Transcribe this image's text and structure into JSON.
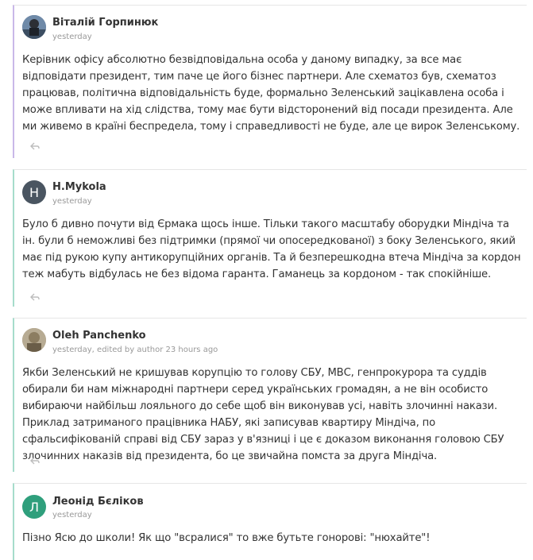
{
  "comments": [
    {
      "author": "Віталій Горпинюк",
      "meta": "yesterday",
      "text": "Керівник офісу абсолютно безвідповідальна особа у даному випадку, за все має відповідати президент, тим паче це його бізнес партнери. Але схематоз був, схематоз працював, політична відповідальність буде, формально Зеленський зацікавлена особа і може впливати на хід слідства, тому має бути відсторонений від посади президента. Але ми живемо в країні беспредела, тому і справедливості не буде, але це вирок Зеленському.",
      "avatar": "photo"
    },
    {
      "author": "H.Mykola",
      "meta": "yesterday",
      "text": "Було б дивно почути від Єрмака щось інше. Тільки такого масштабу оборудки Міндіча та ін. були б неможливі без підтримки (прямої чи опосередкованої) з боку Зеленського, який має під рукою купу антикорупційних органів. Та й безперешкодна втеча Міндіча за кордон теж мабуть відбулась не без відома гаранта. Гаманець за кордоном - так спокійніше.",
      "avatar_letter": "H"
    },
    {
      "author": "Oleh Panchenko",
      "meta": "yesterday, edited by author 23 hours ago",
      "text": "Якби Зеленський не кришував корупцію то голову СБУ, МВС, генпрокурора та суддів обирали би нам міжнародні партнери серед українських громадян, а не він особисто вибираючи найбільш лояльного до себе щоб він виконував усі, навіть злочинні накази. Приклад затриманого працівника НАБУ, які записував квартиру Міндіча, по сфальсифікованій справі від СБУ зараз у в'язниці і це є доказом виконання головою СБУ злочинних наказів від президента, бо це звичайна помста за друга Міндіча.",
      "avatar": "photo"
    },
    {
      "author": "Леонід Бєліков",
      "meta": "yesterday",
      "text": "Пізно Ясю до школи! Як що \"всралися\" то вже бутьте гоноровi: \"нюхайте\"!",
      "avatar_letter": "Л"
    }
  ],
  "colors": {
    "purple_border": "#c9b8e8",
    "teal_border": "#a6dccb",
    "avatar_h": "#4a5561",
    "avatar_l": "#2f9f7c"
  },
  "icons": {
    "reply": "reply-icon"
  }
}
